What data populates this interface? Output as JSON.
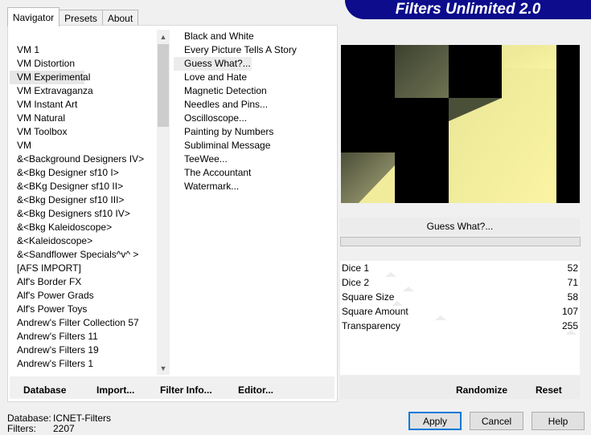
{
  "banner": "Filters Unlimited 2.0",
  "tabs": [
    "Navigator",
    "Presets",
    "About"
  ],
  "categories": [
    "VM 1",
    "VM Distortion",
    "VM Experimental",
    "VM Extravaganza",
    "VM Instant Art",
    "VM Natural",
    "VM Toolbox",
    "VM",
    "&<Background Designers IV>",
    "&<Bkg Designer sf10 I>",
    "&<BKg Designer sf10 II>",
    "&<Bkg Designer sf10 III>",
    "&<Bkg Designers sf10 IV>",
    "&<Bkg Kaleidoscope>",
    "&<Kaleidoscope>",
    "&<Sandflower Specials^v^ >",
    "[AFS IMPORT]",
    "Alf's Border FX",
    "Alf's Power Grads",
    "Alf's Power Toys",
    "Andrew's Filter Collection 57",
    "Andrew's Filters 11",
    "Andrew's Filters 19",
    "Andrew's Filters 1"
  ],
  "selected_category": "VM Experimental",
  "filters": [
    "Black and White",
    "Every Picture Tells A Story",
    "Guess  What?...",
    "Love and Hate",
    "Magnetic Detection",
    "Needles and Pins...",
    "Oscilloscope...",
    "Painting by Numbers",
    "Subliminal Message",
    "TeeWee...",
    "The Accountant",
    "Watermark..."
  ],
  "selected_filter": "Guess  What?...",
  "filter_name": "Guess  What?...",
  "left_buttons": {
    "database": "Database",
    "import": "Import...",
    "filter_info": "Filter Info...",
    "editor": "Editor..."
  },
  "right_buttons": {
    "randomize": "Randomize",
    "reset": "Reset"
  },
  "params": [
    {
      "label": "Dice 1",
      "value": "52",
      "fraction": 0.2
    },
    {
      "label": "Dice 2",
      "value": "71",
      "fraction": 0.28
    },
    {
      "label": "Square Size",
      "value": "58",
      "fraction": 0.23
    },
    {
      "label": "Square Amount",
      "value": "107",
      "fraction": 0.42
    },
    {
      "label": "Transparency",
      "value": "255",
      "fraction": 1.0
    }
  ],
  "status": {
    "database_label": "Database:",
    "database_value": "ICNET-Filters",
    "filters_label": "Filters:",
    "filters_value": "2207"
  },
  "dialog_buttons": {
    "apply": "Apply",
    "cancel": "Cancel",
    "help": "Help"
  }
}
